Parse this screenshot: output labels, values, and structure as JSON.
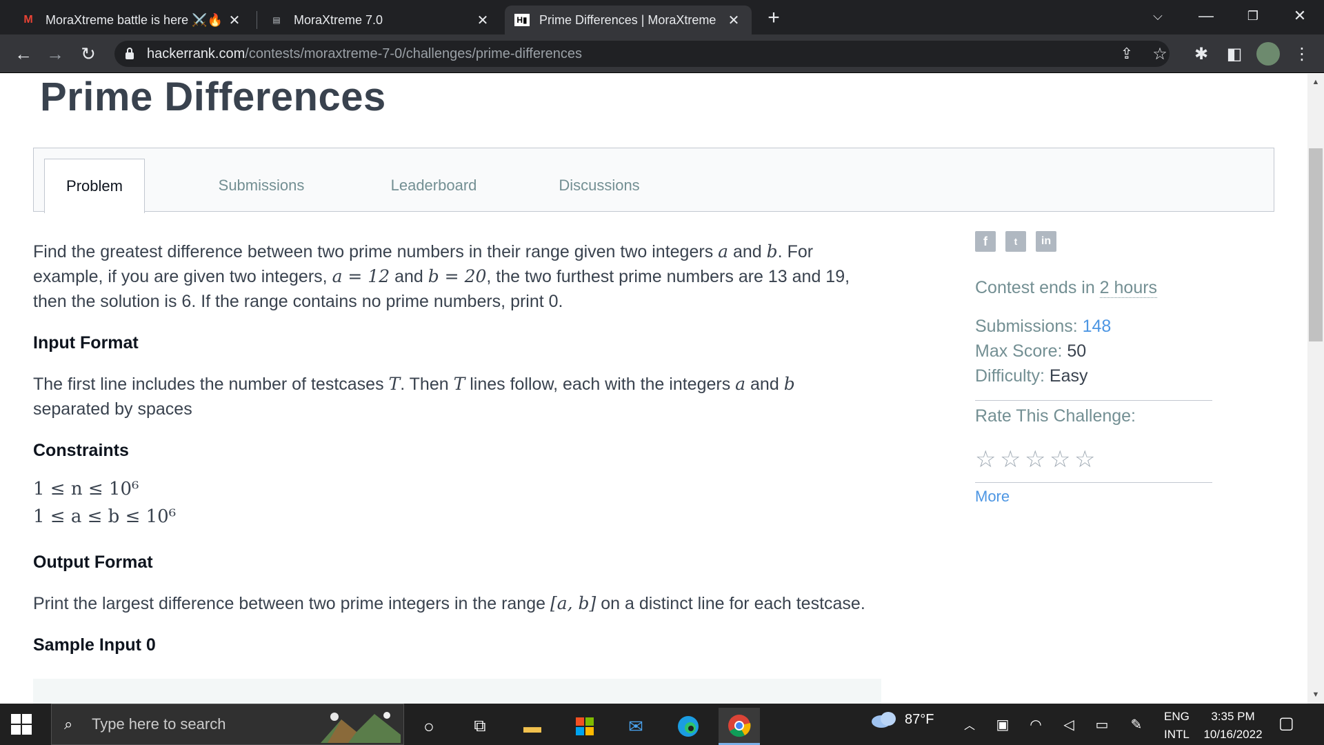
{
  "browser": {
    "tabs": [
      {
        "title": "MoraXtreme battle is here ⚔️🔥",
        "favicon": "gmail-icon"
      },
      {
        "title": "MoraXtreme 7.0",
        "favicon": "site-icon"
      },
      {
        "title": "Prime Differences | MoraXtreme",
        "favicon": "hackerrank-icon"
      }
    ],
    "url_host": "hackerrank.com",
    "url_path": "/contests/moraxtreme-7-0/challenges/prime-differences"
  },
  "page": {
    "title": "Prime Differences",
    "tabs": [
      "Problem",
      "Submissions",
      "Leaderboard",
      "Discussions"
    ],
    "active_tab": "Problem",
    "problem": {
      "p1_a": "Find the greatest difference between two prime numbers in their range given two integers ",
      "p1_var_a": "a",
      "p1_and": " and ",
      "p1_var_b": "b",
      "p1_b": ". For",
      "p1_c": "example, if you are given two integers, ",
      "p1_eq_a": "a = 12",
      "p1_eq_b": "b = 20",
      "p1_d": ", the two furthest prime numbers are 13 and 19,",
      "p1_e": "then the solution is 6. If the range contains no prime numbers, print 0.",
      "input_heading": "Input Format",
      "input_a": "The first line includes the number of testcases ",
      "input_T": "T",
      "input_b": ". Then ",
      "input_c": " lines follow, each with the integers ",
      "input_d": "separated by spaces",
      "constraints_heading": "Constraints",
      "constraint_1": "1 ≤ n ≤ 10⁶",
      "constraint_2": "1 ≤ a ≤ b ≤ 10⁶",
      "output_heading": "Output Format",
      "output_a": "Print the largest difference between two prime integers in the range ",
      "output_range": "[a, b]",
      "output_b": " on a distinct line for each testcase.",
      "sample_heading": "Sample Input 0"
    },
    "sidebar": {
      "social": [
        "f",
        "t",
        "in"
      ],
      "contest_ends_label": "Contest ends in ",
      "contest_ends_value": "2 hours",
      "submissions_label": "Submissions: ",
      "submissions_value": "148",
      "max_score_label": "Max Score: ",
      "max_score_value": "50",
      "difficulty_label": "Difficulty: ",
      "difficulty_value": "Easy",
      "rate_label": "Rate This Challenge:",
      "rating_stars": 0,
      "more_link": "More"
    }
  },
  "taskbar": {
    "search_placeholder": "Type here to search",
    "weather_temp": "87°F",
    "lang_1": "ENG",
    "lang_2": "INTL",
    "time": "3:35 PM",
    "date": "10/16/2022"
  }
}
